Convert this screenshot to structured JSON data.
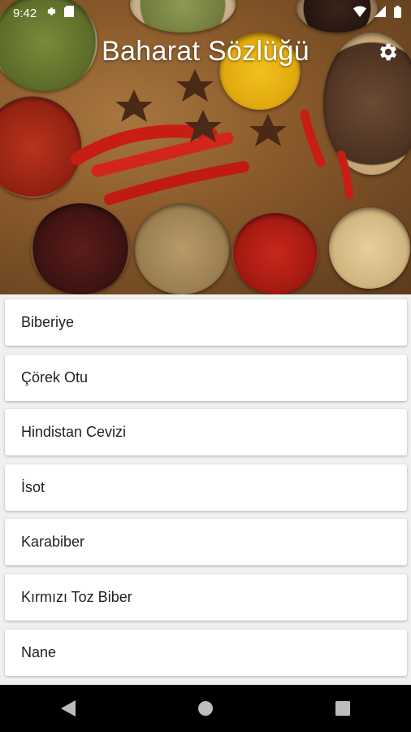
{
  "status_bar": {
    "time": "9:42"
  },
  "header": {
    "title": "Baharat Sözlüğü"
  },
  "spices": [
    {
      "label": "Biberiye"
    },
    {
      "label": "Çörek Otu"
    },
    {
      "label": "Hindistan Cevizi"
    },
    {
      "label": "İsot"
    },
    {
      "label": "Karabiber"
    },
    {
      "label": "Kırmızı Toz Biber"
    },
    {
      "label": "Nane"
    }
  ],
  "icons": {
    "settings": "gear-icon",
    "nav_back": "back-triangle-icon",
    "nav_home": "home-circle-icon",
    "nav_recents": "recents-square-icon"
  },
  "colors": {
    "navbar": "#000000",
    "list_background": "#f0f0f0",
    "card": "#ffffff"
  }
}
